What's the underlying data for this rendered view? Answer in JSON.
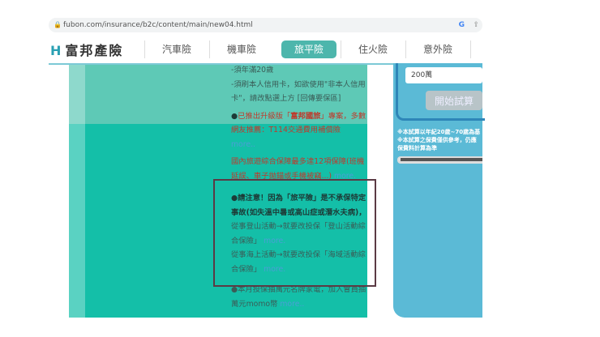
{
  "browser": {
    "url": "fubon.com/insurance/b2c/content/main/new04.html",
    "google": "G",
    "share": "⇪"
  },
  "nav": {
    "logo": "富邦產險",
    "logo_mark": "H",
    "tabs": [
      {
        "label": "汽車險"
      },
      {
        "label": "機車險"
      },
      {
        "label": "旅平險",
        "active": true
      },
      {
        "label": "住火險"
      },
      {
        "label": "意外險"
      }
    ]
  },
  "content": {
    "line1": "-須年滿20歲",
    "line2": "-須刷本人信用卡，如欲使用\"非本人信用卡\"，請改點選上方 [回傳要保區]",
    "promo1_a": "●",
    "promo1_b": "已推出升級版「",
    "promo1_c": "富邦國旅",
    "promo1_d": "」專案，多數網友推薦：T114交通費用補償險",
    "more": "more..",
    "promo2": "國內旅遊綜合保障最多達12項保障(班機延誤、車子拋錨或手機被竊...)",
    "notice_title": "●請注意！因為「旅平險」是不承保特定事故(如失溫中暑或高山症或潛水夫病)，",
    "notice_1": "從事登山活動→就要改投保「登山活動綜合保險」",
    "notice_2": "從事海上活動→就要改投保「海域活動綜合保險」",
    "promo3": "●本月投保抽萬元名牌家電，加入會員抽萬元momo幣",
    "more_dot": "more."
  },
  "calc": {
    "amount": "200萬",
    "button": "開始試算",
    "note1": "※本試算以年紀20歲~70歲為基",
    "note2": "※本試算之保費僅供參考，仍應",
    "note3": "保費料計算為準"
  }
}
